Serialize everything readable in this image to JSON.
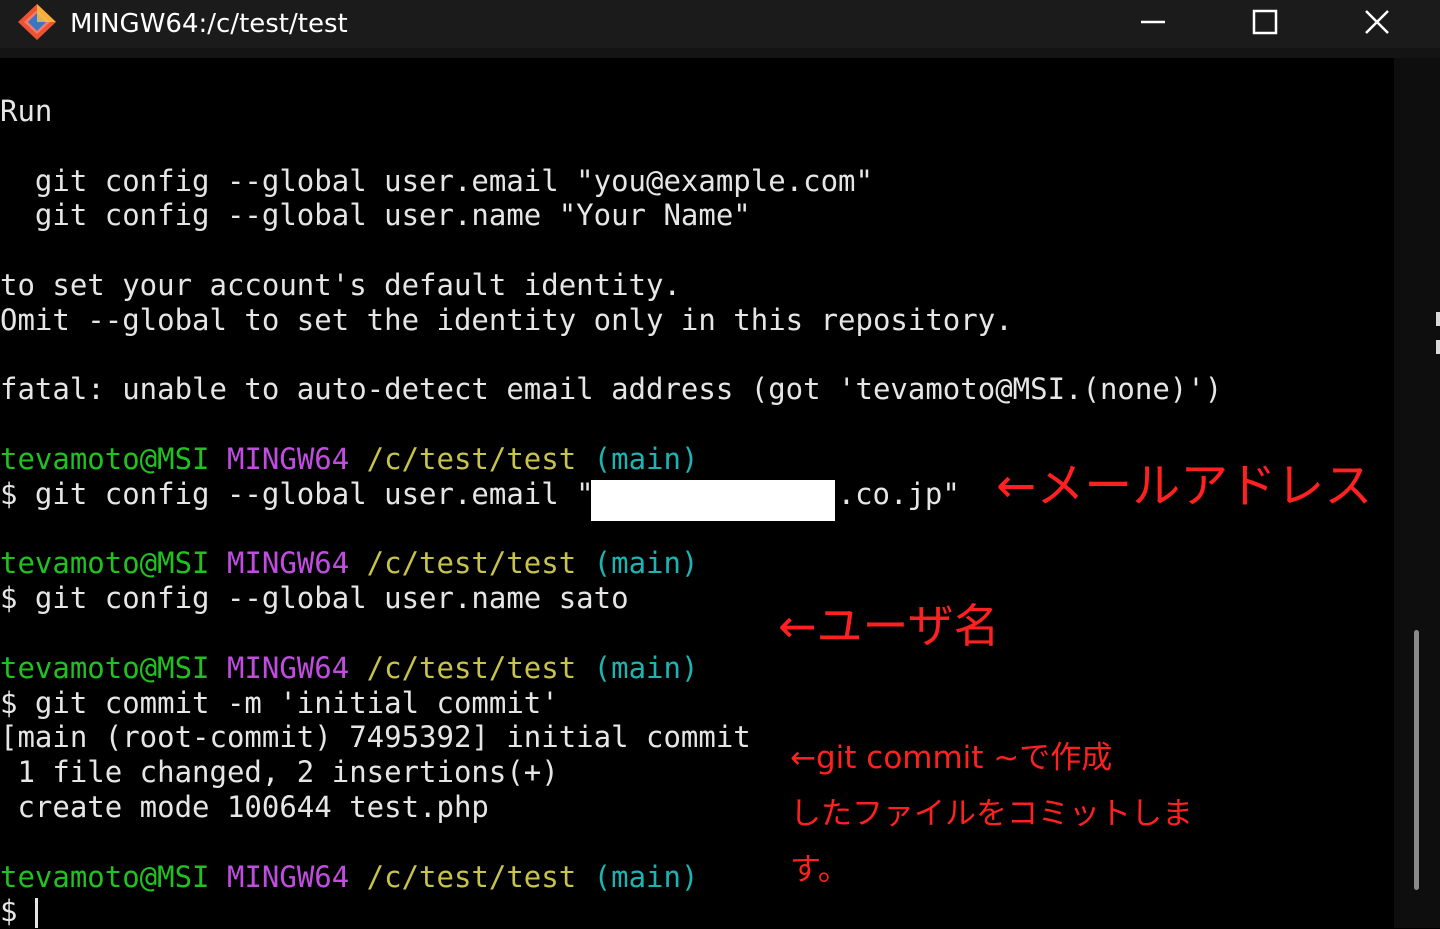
{
  "window": {
    "title": "MINGW64:/c/test/test",
    "icon": "git-bash-icon",
    "controls": [
      "minimize-icon",
      "maximize-icon",
      "close-icon"
    ]
  },
  "colors": {
    "background": "#000000",
    "text": "#e6e6e6",
    "prompt_user": "#1fc21f",
    "prompt_system": "#c04de0",
    "prompt_path": "#c8c34a",
    "prompt_branch": "#1eb3b3",
    "annotation": "#ff2020"
  },
  "terminal": {
    "lines": [
      "Run",
      "",
      "  git config --global user.email \"you@example.com\"",
      "  git config --global user.name \"Your Name\"",
      "",
      "to set your account's default identity.",
      "Omit --global to set the identity only in this repository.",
      "",
      "fatal: unable to auto-detect email address (got 'tevamoto@MSI.(none)')"
    ],
    "prompt": {
      "user": "tevamoto@MSI",
      "system": "MINGW64",
      "path": "/c/test/test",
      "branch": "(main)"
    },
    "cmd_email_prefix": "$ git config --global user.email \"",
    "cmd_email_suffix": ".co.jp\"",
    "cmd_name": "$ git config --global user.name sato",
    "cmd_commit": "$ git commit -m 'initial commit'",
    "commit_output": [
      "[main (root-commit) 7495392] initial commit",
      " 1 file changed, 2 insertions(+)",
      " create mode 100644 test.php"
    ],
    "final_prompt_symbol": "$ "
  },
  "annotations": {
    "email_note": "←メールアドレス",
    "name_note": "←ユーザ名",
    "commit_note_lines": [
      "←git commit ~で作成",
      "したファイルをコミットしま",
      "す。"
    ]
  }
}
